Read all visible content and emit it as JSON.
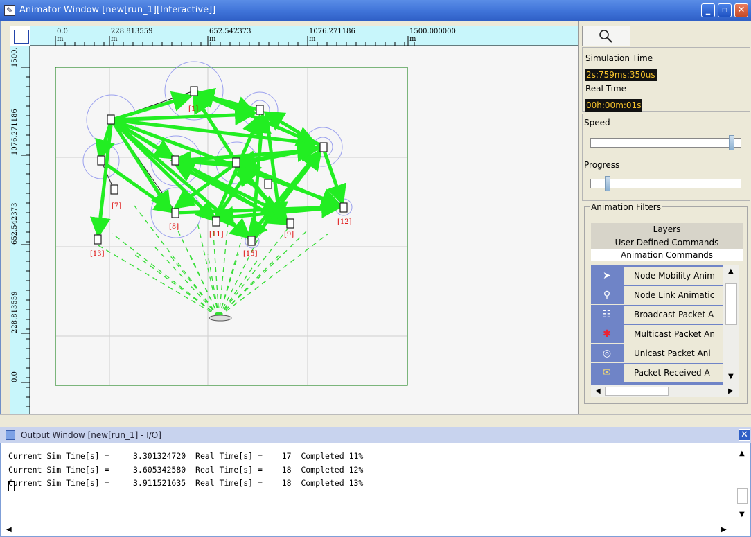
{
  "animator": {
    "title": "Animator Window [new[run_1][Interactive]]",
    "controls": {
      "minimize": "_",
      "restore": "▫",
      "close": "✕"
    },
    "ruler_top": [
      "0.0",
      "228.813559",
      "652.542373",
      "1076.271186",
      "1500.000000"
    ],
    "ruler_unit": "m",
    "ruler_left": [
      "1500.",
      "1076.271186",
      "652.542373",
      "228.813559",
      "0.0"
    ],
    "node_labels": [
      "[1]",
      "[7]",
      "[8]",
      "[11]",
      "[15]",
      "[9]",
      "[12]",
      "[13]"
    ]
  },
  "panel": {
    "zoom_icon": "magnifier-icon",
    "sim_time_label": "Simulation Time",
    "sim_time_value": "2s:759ms:350us",
    "real_time_label": "Real Time",
    "real_time_value": "00h:00m:01s",
    "speed_label": "Speed",
    "progress_label": "Progress",
    "speed_level": 0.95,
    "progress_level": 0.1,
    "filters_label": "Animation Filters",
    "tabs": [
      "Layers",
      "User Defined Commands",
      "Animation Commands"
    ],
    "commands": [
      "Node Mobility Anim",
      "Node Link Animatic",
      "Broadcast Packet A",
      "Multicast Packet An",
      "Unicast Packet Ani",
      "Packet Received A"
    ]
  },
  "output": {
    "title": "Output Window [new[run_1] - I/O]",
    "lines": [
      "Current Sim Time[s] =     3.301324720  Real Time[s] =    17  Completed 11%",
      "Current Sim Time[s] =     3.605342580  Real Time[s] =    18  Completed 12%",
      "Current Sim Time[s] =     3.911521635  Real Time[s] =    18  Completed 13%"
    ]
  },
  "colors": {
    "title_blue": "#3f73d8",
    "arrow_green": "#22ee22",
    "time_text": "#f6c22d",
    "node_label": "#dd0000"
  }
}
